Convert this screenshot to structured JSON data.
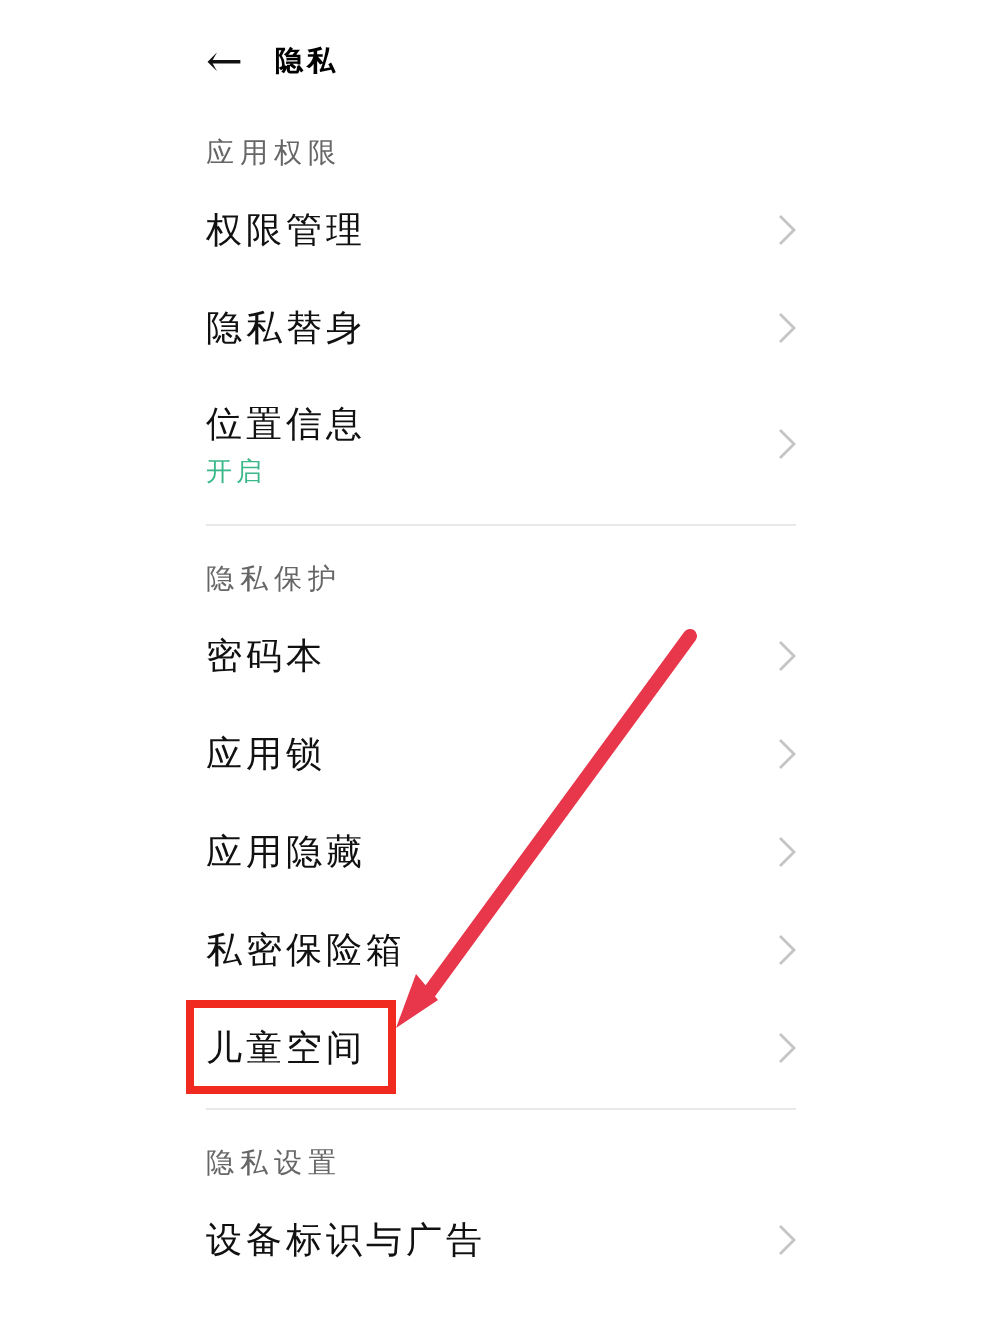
{
  "header": {
    "back_icon": "←",
    "title": "隐私"
  },
  "sections": [
    {
      "title": "应用权限",
      "items": [
        {
          "label": "权限管理",
          "highlighted": false
        },
        {
          "label": "隐私替身",
          "highlighted": false
        },
        {
          "label": "位置信息",
          "status": "开启",
          "highlighted": false
        }
      ]
    },
    {
      "title": "隐私保护",
      "items": [
        {
          "label": "密码本",
          "highlighted": false
        },
        {
          "label": "应用锁",
          "highlighted": false
        },
        {
          "label": "应用隐藏",
          "highlighted": false
        },
        {
          "label": "私密保险箱",
          "highlighted": false
        },
        {
          "label": "儿童空间",
          "highlighted": true
        }
      ]
    },
    {
      "title": "隐私设置",
      "items": [
        {
          "label": "设备标识与广告",
          "highlighted": false
        }
      ]
    }
  ],
  "annotation": {
    "arrow": true
  }
}
